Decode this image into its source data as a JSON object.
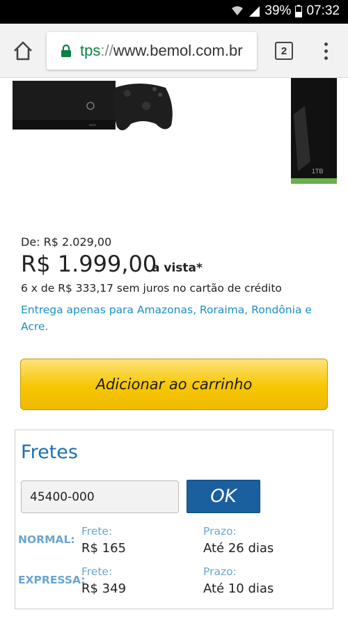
{
  "status_bar": {
    "battery": "39%",
    "time": "07:32"
  },
  "browser": {
    "url_scheme": "tps",
    "url_sep": "://",
    "url_host": "www.bemol.com.br",
    "tab_count": "2"
  },
  "product_images": {
    "box_label": "1TB"
  },
  "price": {
    "from": "De: R$ 2.029,00",
    "current": "R$ 1.999,00",
    "suffix": "a vista*",
    "installments": "6 x de R$ 333,17 sem juros no cartão de crédito",
    "delivery_note": "Entrega apenas para Amazonas, Roraima, Rondônia e Acre."
  },
  "cart_button": "Adicionar ao carrinho",
  "fretes": {
    "title": "Fretes",
    "cep_value": "45400-000",
    "ok_label": "OK",
    "frete_label": "Frete:",
    "prazo_label": "Prazo:",
    "options": [
      {
        "name": "NORMAL:",
        "price": "R$ 165",
        "term": "Até 26 dias"
      },
      {
        "name": "EXPRESSA:",
        "price": "R$ 349",
        "term": "Até 10 dias"
      }
    ]
  },
  "colors": {
    "link": "#1a8fc4",
    "accent_blue": "#1d6fb7",
    "button_yellow": "#f7c600",
    "ok_blue": "#1a5f9e"
  }
}
